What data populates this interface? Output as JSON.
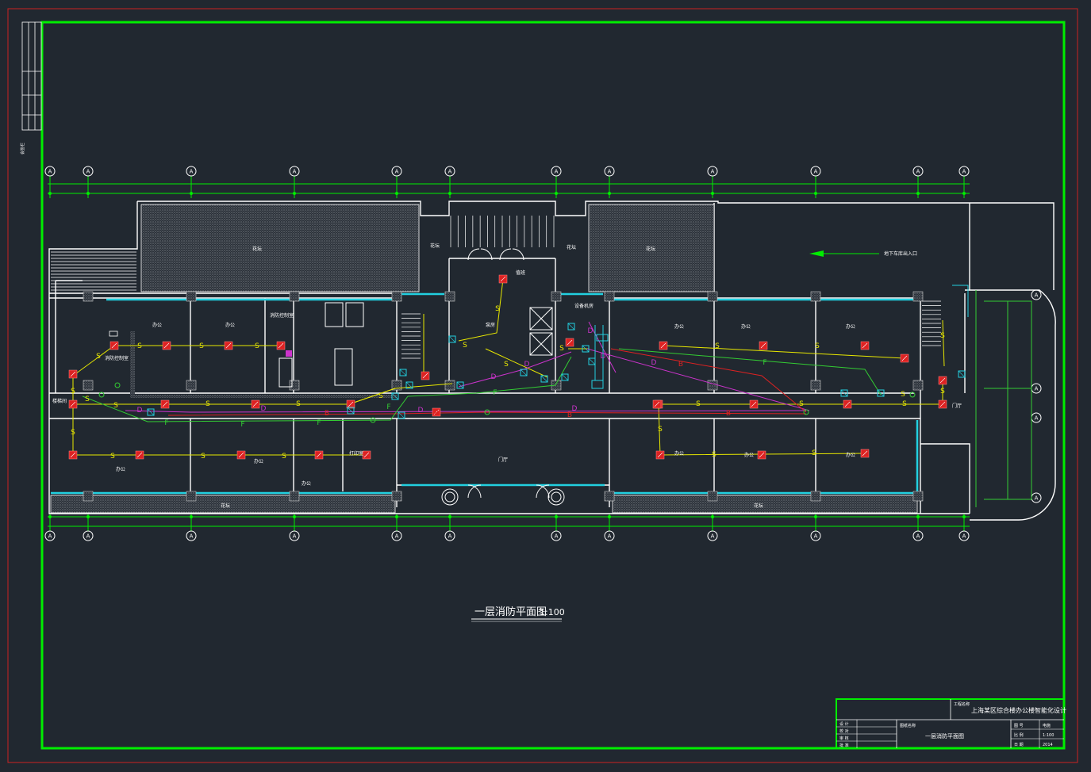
{
  "drawing": {
    "title": "一层消防平面图",
    "scale": "1:100",
    "axis_label": "A"
  },
  "legend": {
    "smoke": "S",
    "heat": "D",
    "fire": "F",
    "broadcast": "B"
  },
  "rooms": {
    "office": "办公",
    "garden": "花坛",
    "lobby": "门厅",
    "duty": "值班",
    "pump": "泵房",
    "control": "消防控制室",
    "fire_room": "消防控制室",
    "print": "打印室",
    "garage": "地下车库出入口",
    "store": "储藏室",
    "mech": "设备机房",
    "vert": "楼梯间",
    "entrance": "门厅"
  },
  "title_block": {
    "project": "上海某区综合楼办公楼智能化设计",
    "drawing_name": "一层消防平面图",
    "project_label": "工程名称",
    "drawing_label": "图纸名称",
    "rows": [
      "设 计",
      "校 对",
      "审 核",
      "批 准"
    ],
    "right_rows": [
      "图 号",
      "比 例",
      "日 期"
    ],
    "values": [
      "电施",
      "1:100",
      "2014"
    ]
  },
  "side_strip": {
    "label": "会签栏"
  },
  "colors": {
    "background": "#212830",
    "frame_green": "#00ee00",
    "frame_red": "#cc2222",
    "wall": "#ffffff",
    "cyan": "#22d0e0",
    "yellow": "#e8e800",
    "magenta": "#cc33cc",
    "red": "#dd2222",
    "green": "#33cc33"
  }
}
